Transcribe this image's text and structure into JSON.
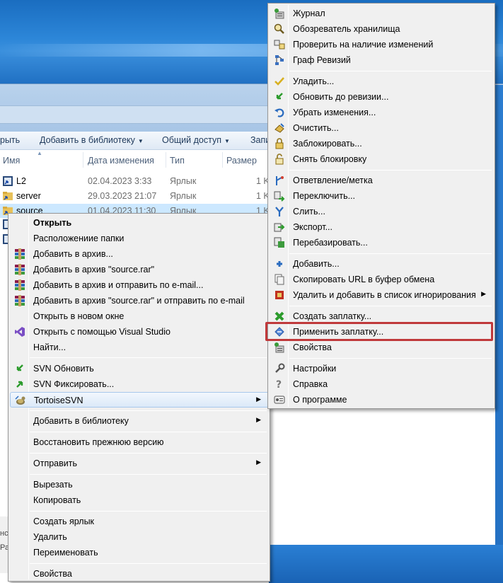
{
  "toolbar": {
    "open_partial": "рыть",
    "add_to_library": "Добавить в библиотеку",
    "share": "Общий доступ",
    "burn_partial": "Запи"
  },
  "columns": {
    "name": "Имя",
    "date": "Дата изменения",
    "type": "Тип",
    "size": "Размер"
  },
  "files": [
    {
      "name": "L2",
      "date": "02.04.2023 3:33",
      "type": "Ярлык",
      "size": "1 K"
    },
    {
      "name": "server",
      "date": "29.03.2023 21:07",
      "type": "Ярлык",
      "size": "1 K"
    },
    {
      "name": "source",
      "date": "01.04.2023 11:30",
      "type": "Ярлык",
      "size": "1 K"
    }
  ],
  "status_partial": "нс\nРаз",
  "main_menu": {
    "items": [
      {
        "label": "Открыть"
      },
      {
        "label": "Расположениие папки"
      },
      {
        "label": "Добавить в архив..."
      },
      {
        "label": "Добавить в архив \"source.rar\""
      },
      {
        "label": "Добавить в архив и отправить по e-mail..."
      },
      {
        "label": "Добавить в архив \"source.rar\" и отправить по e-mail"
      },
      {
        "label": "Открыть в новом окне"
      },
      {
        "label": "Открыть с помощью Visual Studio"
      },
      {
        "label": "Найти..."
      },
      {
        "label": "SVN Обновить"
      },
      {
        "label": "SVN Фиксировать..."
      },
      {
        "label": "TortoiseSVN"
      },
      {
        "label": "Добавить в библиотеку"
      },
      {
        "label": "Восстановить прежнюю версию"
      },
      {
        "label": "Отправить"
      },
      {
        "label": "Вырезать"
      },
      {
        "label": "Копировать"
      },
      {
        "label": "Создать ярлык"
      },
      {
        "label": "Удалить"
      },
      {
        "label": "Переименовать"
      },
      {
        "label": "Свойства"
      }
    ]
  },
  "svn_menu": {
    "items": [
      {
        "label": "Журнал"
      },
      {
        "label": "Обозреватель хранилища"
      },
      {
        "label": "Проверить на наличие изменений"
      },
      {
        "label": "Граф Ревизий"
      },
      {
        "label": "Уладить..."
      },
      {
        "label": "Обновить до ревизии..."
      },
      {
        "label": "Убрать изменения..."
      },
      {
        "label": "Очистить..."
      },
      {
        "label": "Заблокировать..."
      },
      {
        "label": "Снять блокировку"
      },
      {
        "label": "Ответвление/метка"
      },
      {
        "label": "Переключить..."
      },
      {
        "label": "Слить..."
      },
      {
        "label": "Экспорт..."
      },
      {
        "label": "Перебазировать..."
      },
      {
        "label": "Добавить..."
      },
      {
        "label": "Скопировать URL в буфер обмена"
      },
      {
        "label": "Удалить и добавить в список игнорирования"
      },
      {
        "label": "Создать заплатку..."
      },
      {
        "label": "Применить заплатку..."
      },
      {
        "label": "Свойства"
      },
      {
        "label": "Настройки"
      },
      {
        "label": "Справка"
      },
      {
        "label": "О программе"
      }
    ]
  },
  "colors": {
    "highlight": "#c0393b",
    "menu_bg": "#f0f0f0",
    "selection": "#cce8ff"
  }
}
